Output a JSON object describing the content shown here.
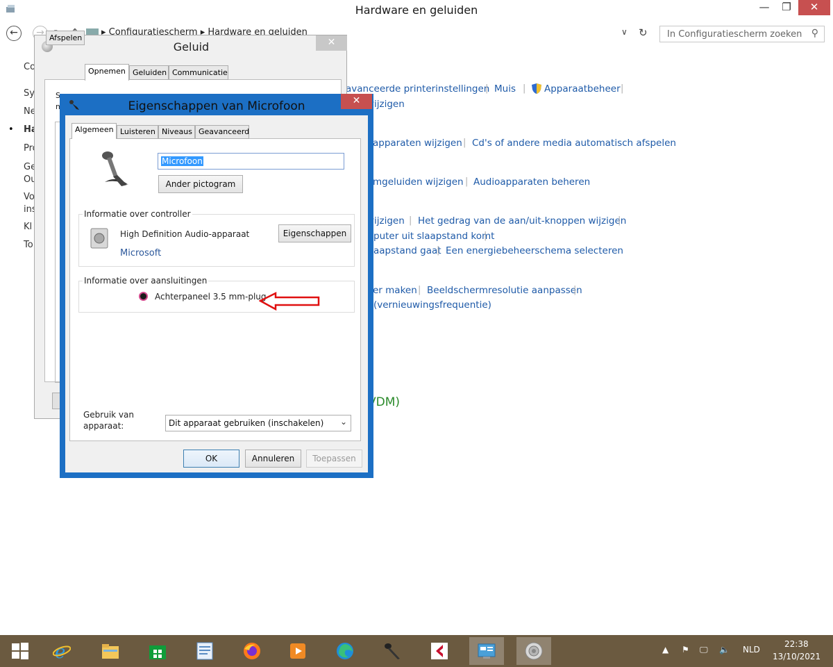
{
  "window": {
    "title": "Hardware en geluiden",
    "minimize_glyph": "—",
    "maximize_glyph": "❐",
    "close_glyph": "✕"
  },
  "address": {
    "back_glyph": "←",
    "forward_glyph": "→",
    "recent_glyph": "▾",
    "up_glyph": "↑",
    "breadcrumb": "▸ Configuratiescherm ▸ Hardware en geluiden",
    "dropdown_glyph": "∨",
    "refresh_glyph": "↻",
    "search_placeholder": "In Configuratiescherm zoeken",
    "search_glyph": "⚲"
  },
  "left_nav": {
    "items": [
      {
        "label": "Co"
      },
      {
        "label": "Sy"
      },
      {
        "label": "Ne"
      },
      {
        "label": "Ha"
      },
      {
        "label": "Pro"
      },
      {
        "label": "Ge"
      },
      {
        "label": "Ou"
      },
      {
        "label": "Vo"
      },
      {
        "label": "ins"
      },
      {
        "label": "Kl"
      },
      {
        "label": "To"
      }
    ],
    "bullet": "•"
  },
  "main_links": {
    "row1": [
      "avanceerde printerinstellingen",
      "Muis",
      "Apparaatbeheer"
    ],
    "row1b": "vijzigen",
    "row2": [
      "apparaten wijzigen",
      "Cd's of andere media automatisch afspelen"
    ],
    "row3": [
      "mgeluiden wijzigen",
      "Audioapparaten beheren"
    ],
    "row4": [
      "vijzigen",
      "Het gedrag van de aan/uit-knoppen wijzigen"
    ],
    "row4b": "puter uit slaapstand komt",
    "row4c": [
      "aapstand gaat",
      "Een energiebeheerschema selecteren"
    ],
    "row5": [
      "er maken",
      "Beeldschermresolutie aanpassen"
    ],
    "row5b": "(vernieuwingsfrequentie)",
    "green_heading": "VDM)",
    "separator": "|"
  },
  "geluid_dialog": {
    "title": "Geluid",
    "close_glyph": "✕",
    "tabs": [
      "Afspelen",
      "Opnemen",
      "Geluiden",
      "Communicatie"
    ],
    "active_tab": "Opnemen",
    "text_line1": "S",
    "text_line2": "m"
  },
  "eig_dialog": {
    "title": "Eigenschappen van Microfoon",
    "close_glyph": "✕",
    "tabs": [
      "Algemeen",
      "Luisteren",
      "Niveaus",
      "Geavanceerd"
    ],
    "active_tab": "Algemeen",
    "device_name": "Microfoon",
    "change_icon_button": "Ander pictogram",
    "controller_group": "Informatie over controller",
    "controller_name": "High Definition Audio-apparaat",
    "controller_vendor": "Microsoft",
    "controller_properties_button": "Eigenschappen",
    "jack_group": "Informatie over aansluitingen",
    "jack_name": "Achterpaneel 3.5 mm-plug",
    "jack_color": "#d14a8c",
    "arrow_color": "#e01010",
    "usage_label": "Gebruik van apparaat:",
    "usage_value": "Dit apparaat gebruiken (inschakelen)",
    "usage_dropdown_glyph": "⌄",
    "ok": "OK",
    "cancel": "Annuleren",
    "apply": "Toepassen"
  },
  "taskbar": {
    "items": [
      {
        "icon": "windows-start-icon"
      },
      {
        "icon": "internet-explorer-icon"
      },
      {
        "icon": "file-explorer-icon"
      },
      {
        "icon": "store-icon"
      },
      {
        "icon": "wordpad-icon"
      },
      {
        "icon": "firefox-icon"
      },
      {
        "icon": "media-player-icon"
      },
      {
        "icon": "edge-icon"
      },
      {
        "icon": "microphone-app-icon"
      },
      {
        "icon": "cubase-icon"
      },
      {
        "icon": "control-panel-icon"
      },
      {
        "icon": "speaker-app-icon"
      }
    ],
    "tray_expand": "▲",
    "tray_flag": "⚑",
    "tray_network": "🖵",
    "tray_volume": "🔈",
    "language": "NLD",
    "time": "22:38",
    "date": "13/10/2021"
  },
  "colors": {
    "link": "#1e5aa8",
    "dialog_frame": "#1c6fc4",
    "taskbar": "#6b5a40",
    "close_red": "#c75050"
  }
}
